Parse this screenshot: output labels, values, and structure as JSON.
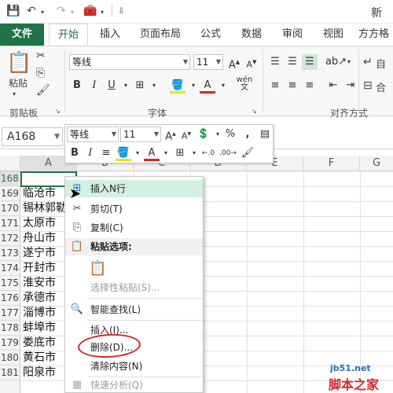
{
  "window": {
    "title": "新"
  },
  "quick_access": {
    "save_icon": "save-icon",
    "undo_icon": "undo-icon",
    "redo_icon": "redo-icon",
    "customize_icon": "customize-icon"
  },
  "tabs": [
    {
      "label": "文件"
    },
    {
      "label": "开始"
    },
    {
      "label": "插入"
    },
    {
      "label": "页面布局"
    },
    {
      "label": "公式"
    },
    {
      "label": "数据"
    },
    {
      "label": "审阅"
    },
    {
      "label": "视图"
    },
    {
      "label": "方方格"
    }
  ],
  "ribbon": {
    "clipboard": {
      "paste_label": "粘贴",
      "group_label": "剪贴板"
    },
    "font": {
      "font_name": "等线",
      "font_size": "11",
      "group_label": "字体",
      "pinyin": "wén"
    },
    "alignment": {
      "group_label": "对齐方式",
      "wrap_label": "自",
      "merge_label": "合"
    }
  },
  "namebox": {
    "value": "A168"
  },
  "mini_toolbar": {
    "font_name": "等线",
    "font_size": "11",
    "percent": "%",
    "comma": ","
  },
  "columns": [
    "A",
    "B",
    "C",
    "D",
    "E",
    "F",
    "G"
  ],
  "rows": [
    {
      "num": "168",
      "a": ""
    },
    {
      "num": "169",
      "a": "临沧市"
    },
    {
      "num": "170",
      "a": "锡林郭勒"
    },
    {
      "num": "171",
      "a": "太原市"
    },
    {
      "num": "172",
      "a": "舟山市"
    },
    {
      "num": "173",
      "a": "遂宁市"
    },
    {
      "num": "174",
      "a": "开封市"
    },
    {
      "num": "175",
      "a": "淮安市"
    },
    {
      "num": "176",
      "a": "承德市"
    },
    {
      "num": "177",
      "a": "淄博市"
    },
    {
      "num": "178",
      "a": "蚌埠市"
    },
    {
      "num": "179",
      "a": "娄底市"
    },
    {
      "num": "180",
      "a": "黄石市"
    },
    {
      "num": "181",
      "a": "阳泉市"
    }
  ],
  "context_menu": {
    "insert_rows": "插入N行",
    "cut": "剪切(T)",
    "copy": "复制(C)",
    "paste_options": "粘贴选项:",
    "paste_special": "选择性粘贴(S)...",
    "smart_lookup": "智能查找(L)",
    "insert": "插入(I)...",
    "delete": "删除(D)...",
    "clear_contents": "清除内容(N)",
    "quick_analysis": "快速分析(Q)"
  },
  "watermark": {
    "line1": "jb51.net",
    "line2": "脚本之家"
  },
  "colors": {
    "accent": "#217346",
    "highlight": "#d3f0e0",
    "annotation": "#d6262c"
  }
}
